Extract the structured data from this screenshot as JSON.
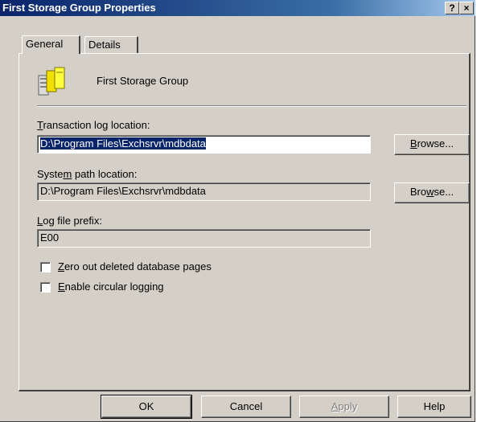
{
  "window": {
    "title": "First Storage Group Properties",
    "help_button": "?",
    "close_button": "×"
  },
  "tabs": [
    {
      "label": "General",
      "selected": true
    },
    {
      "label": "Details",
      "selected": false
    }
  ],
  "general": {
    "storage_group_name": "First Storage Group",
    "transaction_log": {
      "label_accesskey": "T",
      "label_rest": "ransaction log location:",
      "value": "D:\\Program Files\\Exchsrvr\\mdbdata",
      "browse": {
        "before": "",
        "accesskey": "B",
        "after": "rowse..."
      }
    },
    "system_path": {
      "label_before": "Syste",
      "label_accesskey": "m",
      "label_after": " path location:",
      "value": "D:\\Program Files\\Exchsrvr\\mdbdata",
      "browse": {
        "before": "Bro",
        "accesskey": "w",
        "after": "se..."
      }
    },
    "log_prefix": {
      "label_accesskey": "L",
      "label_rest": "og file prefix:",
      "value": "E00"
    },
    "zero_out": {
      "accesskey": "Z",
      "rest": "ero out deleted database pages",
      "checked": false
    },
    "circular_logging": {
      "accesskey": "E",
      "rest": "nable circular logging",
      "checked": false
    }
  },
  "buttons": {
    "ok": "OK",
    "cancel": "Cancel",
    "apply_accesskey": "A",
    "apply_rest": "pply",
    "help": "Help"
  },
  "colors": {
    "title_bar": "#0a246a",
    "dialog_face": "#d4d0c8",
    "selection": "#0a246a"
  }
}
